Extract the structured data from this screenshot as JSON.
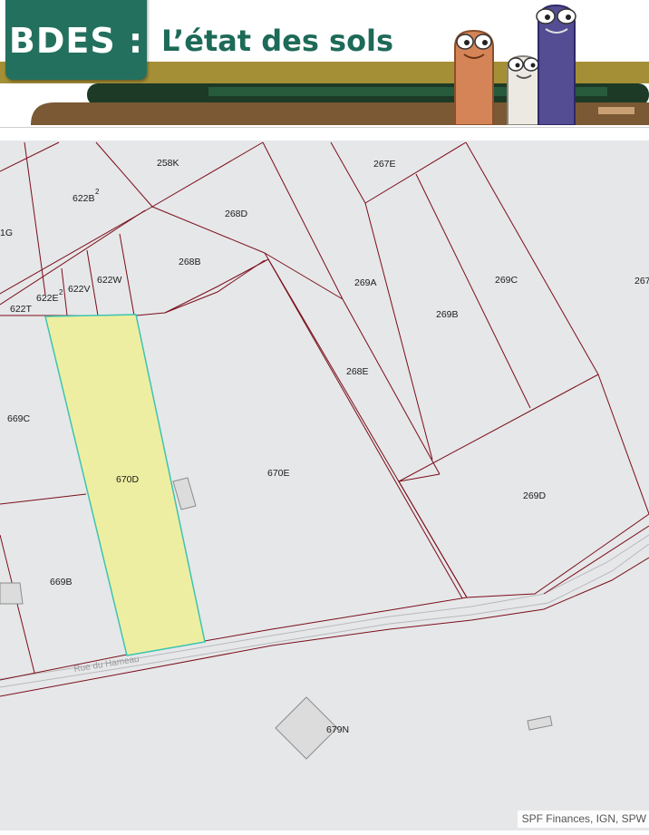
{
  "header": {
    "logo_text": "BDES :",
    "subtitle": "L’état des sols"
  },
  "map": {
    "parcels": {
      "p258K": "258K",
      "p267E": "267E",
      "p622B2": "622B",
      "p622B2_sup": "2",
      "p268D": "268D",
      "p1G": "1G",
      "p268B": "268B",
      "p622W": "622W",
      "p269A": "269A",
      "p269C": "269C",
      "p267_cut": "267",
      "p622V": "622V",
      "p622E2": "622E",
      "p622E2_sup": "2",
      "p622T": "622T",
      "p269B": "269B",
      "p268E": "268E",
      "p669C": "669C",
      "p670D": "670D",
      "p670E": "670E",
      "p269D": "269D",
      "p669B": "669B",
      "p679N": "679N"
    },
    "street_name": "Rue du Hameau",
    "selected_parcel": "670D",
    "colors": {
      "map_background": "#e6e7e9",
      "parcel_line": "#7a0e1a",
      "selected_fill": "#eeeea2",
      "selected_stroke": "#3cc4b0",
      "building_fill": "#dcdcdc",
      "road_line": "#b9b9bb"
    }
  },
  "attribution": "SPF Finances, IGN, SPW"
}
